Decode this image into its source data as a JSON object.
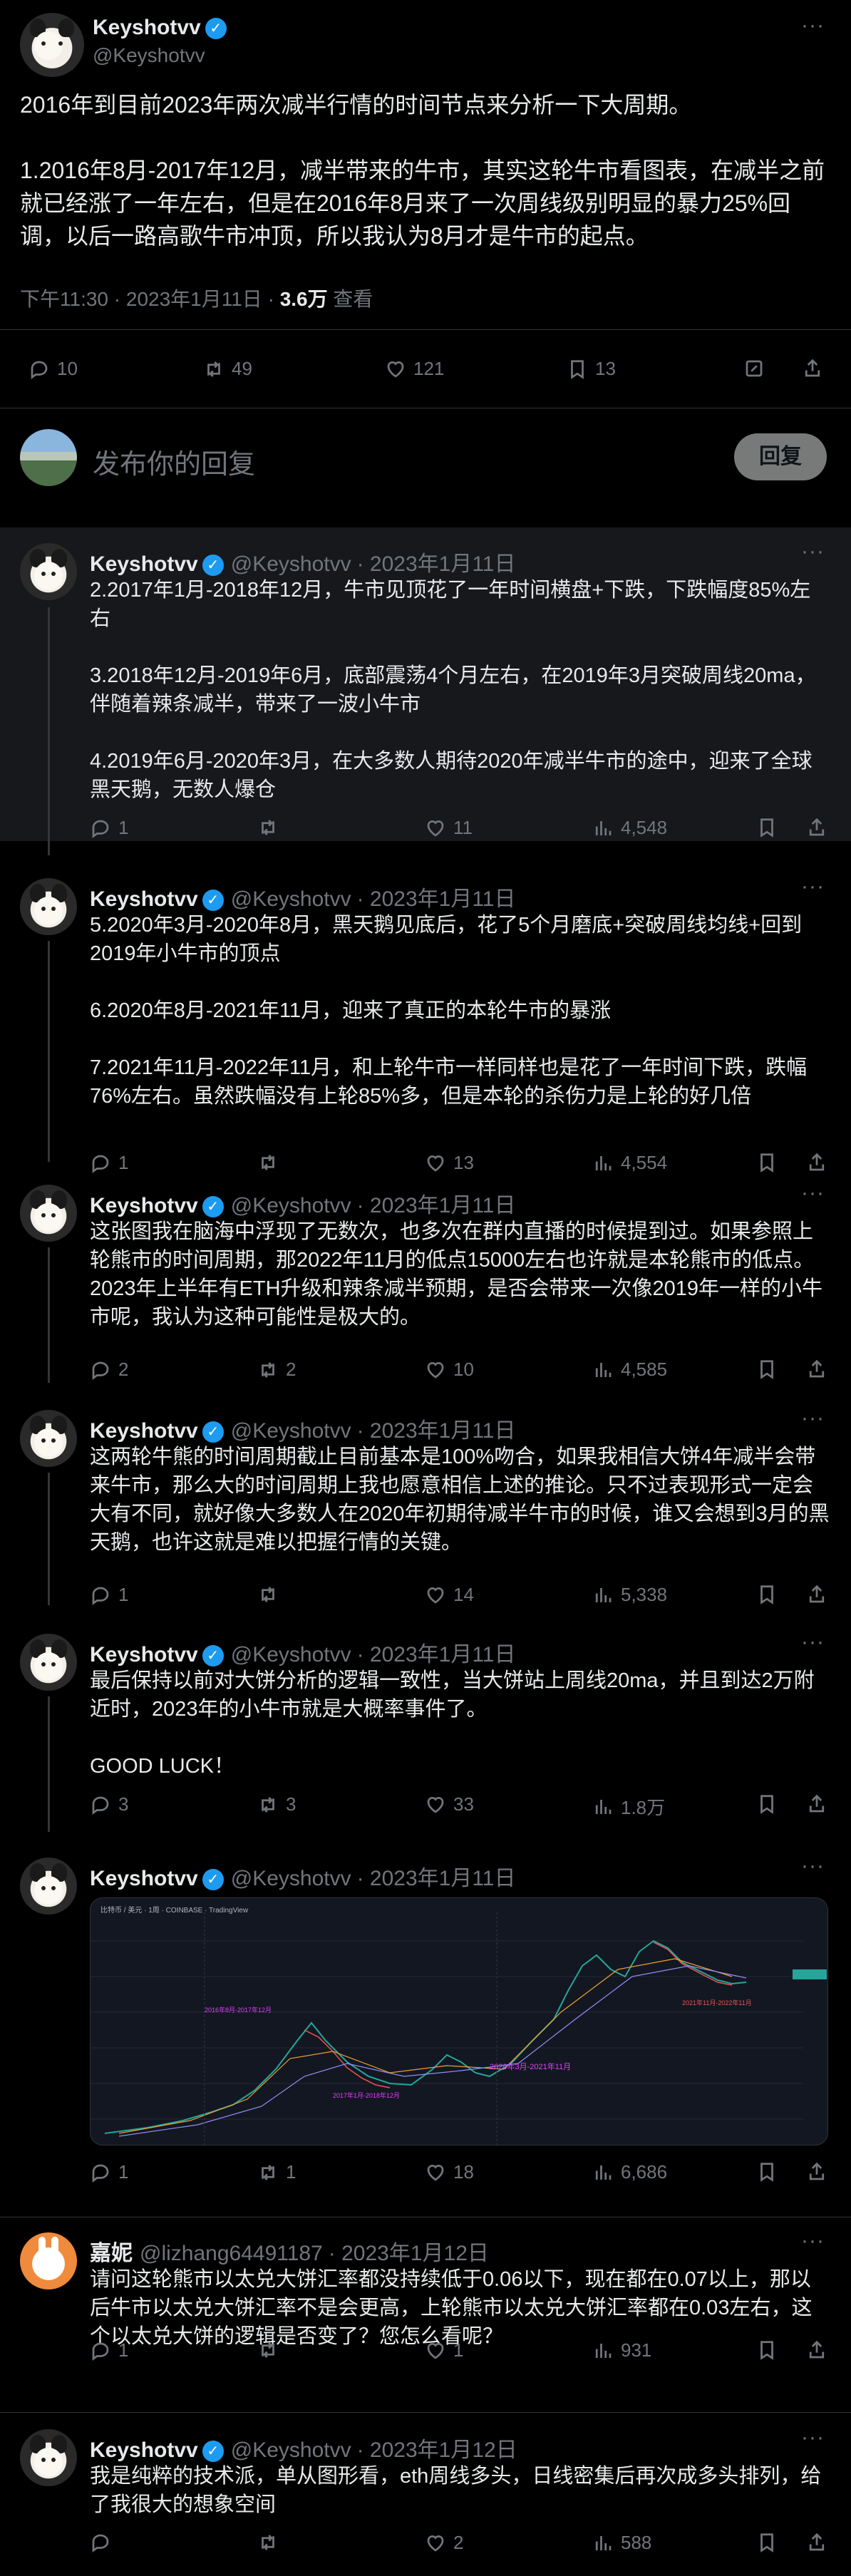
{
  "main_tweet": {
    "author_name": "Keyshotvv",
    "author_handle": "@Keyshotvv",
    "text": "2016年到目前2023年两次减半行情的时间节点来分析一下大周期。\n\n1.2016年8月-2017年12月，减半带来的牛市，其实这轮牛市看图表，在减半之前就已经涨了一年左右，但是在2016年8月来了一次周线级别明显的暴力25%回调，以后一路高歌牛市冲顶，所以我认为8月才是牛市的起点。",
    "time": "下午11:30 · 2023年1月11日 · ",
    "views_count": "3.6万",
    "views_label": " 查看",
    "replies": "10",
    "retweets": "49",
    "likes": "121",
    "bookmarks": "13"
  },
  "reply_box": {
    "placeholder": "发布你的回复",
    "button": "回复"
  },
  "replies": [
    {
      "name": "Keyshotvv",
      "verified": true,
      "handle": "@Keyshotvv",
      "date": "· 2023年1月11日",
      "text": "2.2017年1月-2018年12月，牛市见顶花了一年时间横盘+下跌，下跌幅度85%左右\n\n3.2018年12月-2019年6月，底部震荡4个月左右，在2019年3月突破周线20ma，伴随着辣条减半，带来了一波小牛市\n\n4.2019年6月-2020年3月，在大多数人期待2020年减半牛市的途中，迎来了全球黑天鹅，无数人爆仓",
      "replies": "1",
      "retweets": "",
      "likes": "11",
      "views": "4,548"
    },
    {
      "name": "Keyshotvv",
      "verified": true,
      "handle": "@Keyshotvv",
      "date": "· 2023年1月11日",
      "text": "5.2020年3月-2020年8月，黑天鹅见底后，花了5个月磨底+突破周线均线+回到2019年小牛市的顶点\n\n6.2020年8月-2021年11月，迎来了真正的本轮牛市的暴涨\n\n7.2021年11月-2022年11月，和上轮牛市一样同样也是花了一年时间下跌，跌幅76%左右。虽然跌幅没有上轮85%多，但是本轮的杀伤力是上轮的好几倍",
      "replies": "1",
      "retweets": "",
      "likes": "13",
      "views": "4,554"
    },
    {
      "name": "Keyshotvv",
      "verified": true,
      "handle": "@Keyshotvv",
      "date": "· 2023年1月11日",
      "text": "这张图我在脑海中浮现了无数次，也多次在群内直播的时候提到过。如果参照上轮熊市的时间周期，那2022年11月的低点15000左右也许就是本轮熊市的低点。2023年上半年有ETH升级和辣条减半预期，是否会带来一次像2019年一样的小牛市呢，我认为这种可能性是极大的。",
      "replies": "2",
      "retweets": "2",
      "likes": "10",
      "views": "4,585"
    },
    {
      "name": "Keyshotvv",
      "verified": true,
      "handle": "@Keyshotvv",
      "date": "· 2023年1月11日",
      "text": "这两轮牛熊的时间周期截止目前基本是100%吻合，如果我相信大饼4年减半会带来牛市，那么大的时间周期上我也愿意相信上述的推论。只不过表现形式一定会大有不同，就好像大多数人在2020年初期待减半牛市的时候，谁又会想到3月的黑天鹅，也许这就是难以把握行情的关键。",
      "replies": "1",
      "retweets": "",
      "likes": "14",
      "views": "5,338"
    },
    {
      "name": "Keyshotvv",
      "verified": true,
      "handle": "@Keyshotvv",
      "date": "· 2023年1月11日",
      "text": "最后保持以前对大饼分析的逻辑一致性，当大饼站上周线20ma，并且到达2万附近时，2023年的小牛市就是大概率事件了。\n\nGOOD LUCK！",
      "replies": "3",
      "retweets": "3",
      "likes": "33",
      "views": "1.8万"
    },
    {
      "name": "Keyshotvv",
      "verified": true,
      "handle": "@Keyshotvv",
      "date": "· 2023年1月11日",
      "text": "",
      "has_image": true,
      "replies": "1",
      "retweets": "1",
      "likes": "18",
      "views": "6,686"
    },
    {
      "name": "嘉妮",
      "verified": false,
      "handle": "@lizhang64491187",
      "date": "· 2023年1月12日",
      "text": "请问这轮熊市以太兑大饼汇率都没持续低于0.06以下，现在都在0.07以上，那以后牛市以太兑大饼汇率不是会更高，上轮熊市以太兑大饼汇率都在0.03左右，这个以太兑大饼的逻辑是否变了？您怎么看呢？",
      "replies": "1",
      "retweets": "",
      "likes": "1",
      "views": "931"
    },
    {
      "name": "Keyshotvv",
      "verified": true,
      "handle": "@Keyshotvv",
      "date": "· 2023年1月12日",
      "text": "我是纯粹的技术派，单从图形看，eth周线多头，日线密集后再次成多头排列，给了我很大的想象空间",
      "replies": "",
      "retweets": "",
      "likes": "2",
      "views": "588"
    }
  ],
  "chart_image": {
    "header": "比特币 / 美元 · 1周 · COINBASE · TradingView",
    "annotations": [
      "2016年8月-2017年12月",
      "2017年1月-2018年12月",
      "2020年3月-2021年11月",
      "2021年11月-2022年11月"
    ]
  },
  "colors": {
    "background": "#000000",
    "text": "#e7e9ea",
    "muted": "#71767b",
    "accent": "#1d9bf0",
    "separator": "#2f3336"
  }
}
